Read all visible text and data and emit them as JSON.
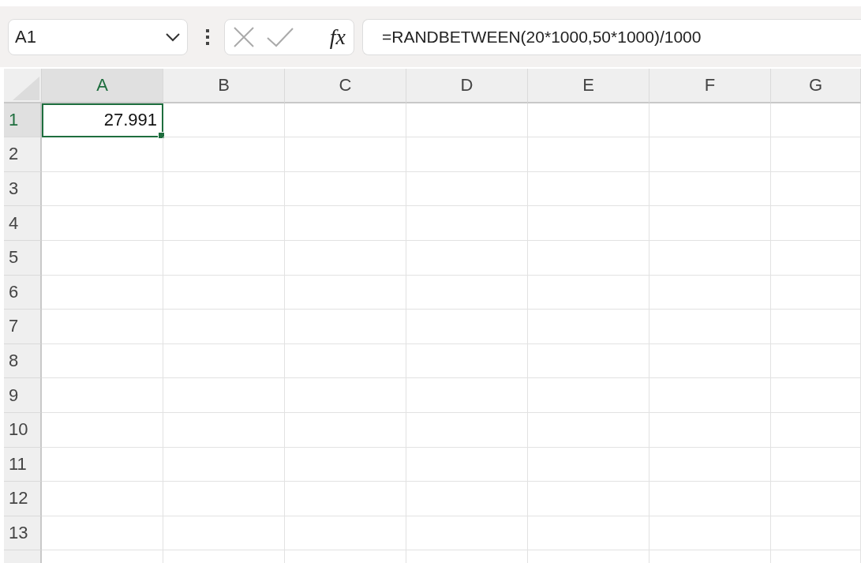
{
  "name_box": {
    "value": "A1"
  },
  "formula_bar": {
    "function_label": "fx",
    "formula": "=RANDBETWEEN(20*1000,50*1000)/1000"
  },
  "columns": [
    {
      "label": "A",
      "selected": true
    },
    {
      "label": "B",
      "selected": false
    },
    {
      "label": "C",
      "selected": false
    },
    {
      "label": "D",
      "selected": false
    },
    {
      "label": "E",
      "selected": false
    },
    {
      "label": "F",
      "selected": false
    },
    {
      "label": "G",
      "selected": false
    }
  ],
  "rows": [
    {
      "label": "1",
      "selected": true,
      "cells": [
        {
          "text": "27.991",
          "selected": true
        }
      ]
    },
    {
      "label": "2",
      "selected": false
    },
    {
      "label": "3",
      "selected": false
    },
    {
      "label": "4",
      "selected": false
    },
    {
      "label": "5",
      "selected": false
    },
    {
      "label": "6",
      "selected": false
    },
    {
      "label": "7",
      "selected": false
    },
    {
      "label": "8",
      "selected": false
    },
    {
      "label": "9",
      "selected": false
    },
    {
      "label": "10",
      "selected": false
    },
    {
      "label": "11",
      "selected": false
    },
    {
      "label": "12",
      "selected": false
    },
    {
      "label": "13",
      "selected": false
    }
  ]
}
